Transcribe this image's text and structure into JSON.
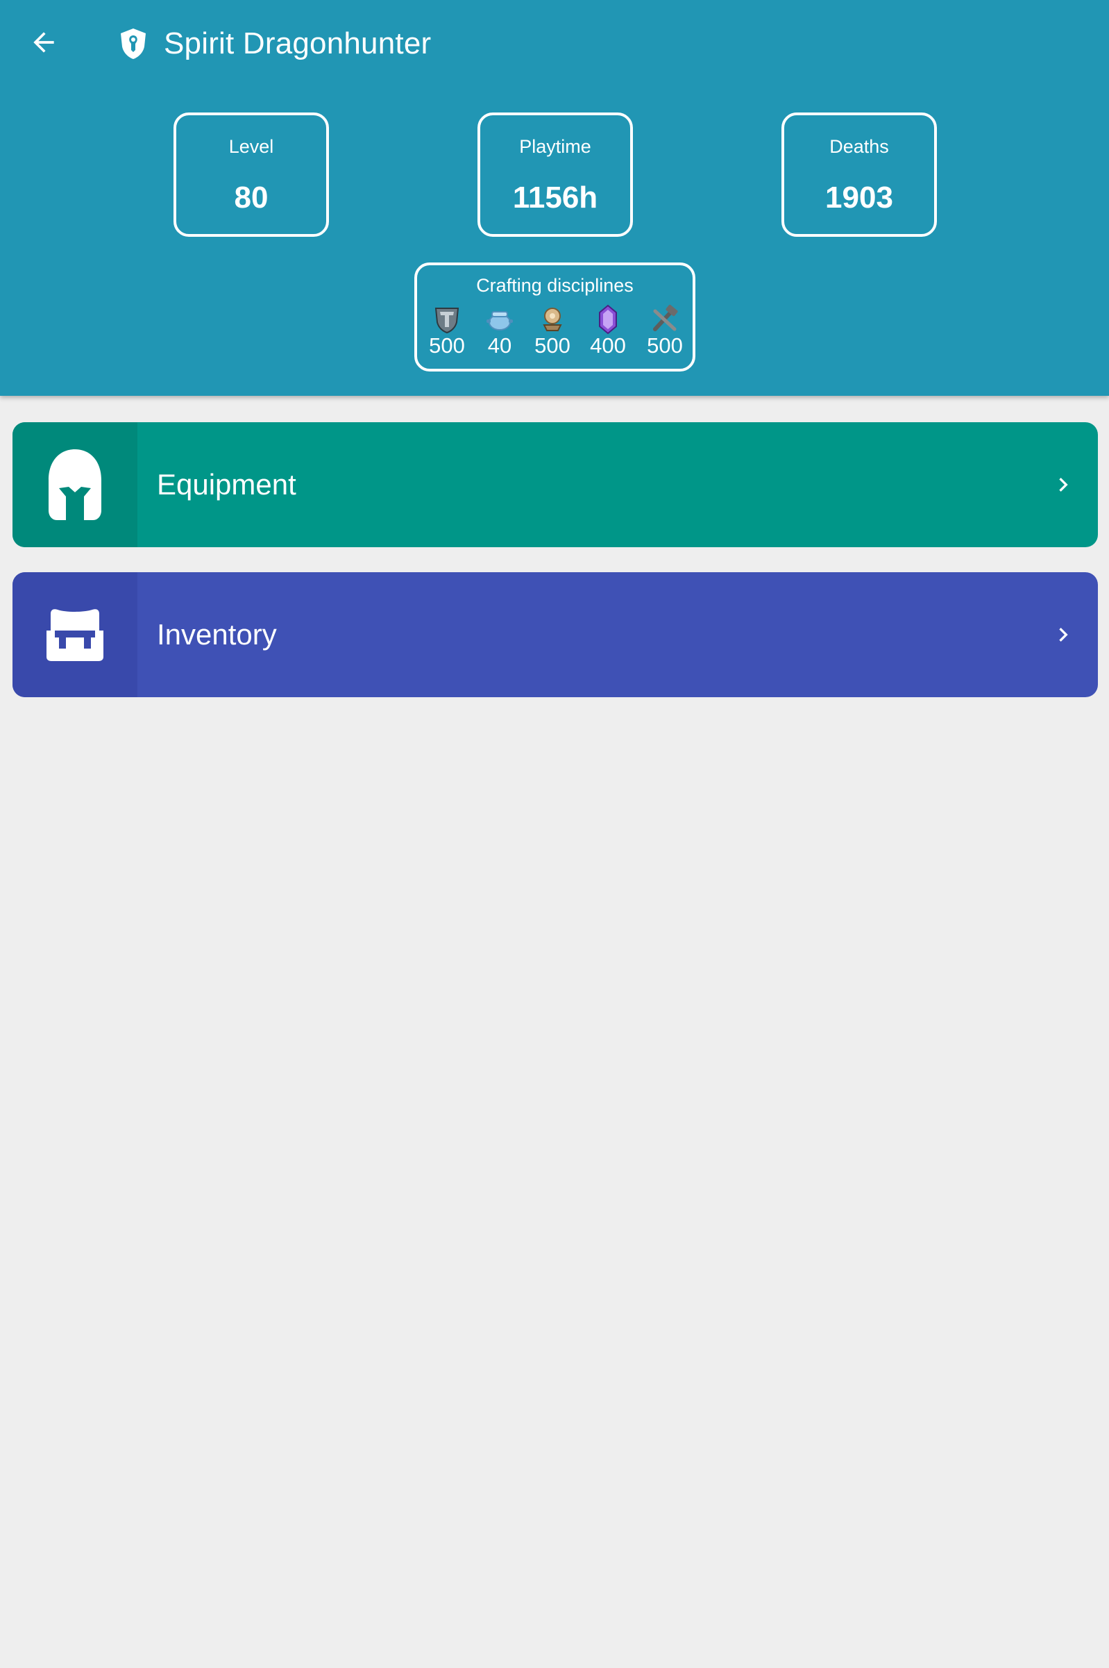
{
  "header": {
    "title": "Spirit Dragonhunter",
    "back_icon": "arrow-back-icon",
    "class_icon": "dragonhunter-icon",
    "background": "#2196b4"
  },
  "stats": {
    "level": {
      "label": "Level",
      "value": "80"
    },
    "playtime": {
      "label": "Playtime",
      "value": "1156h"
    },
    "deaths": {
      "label": "Deaths",
      "value": "1903"
    }
  },
  "crafting": {
    "label": "Crafting disciplines",
    "disciplines": [
      {
        "icon": "armorsmith-icon",
        "value": "500"
      },
      {
        "icon": "chef-icon",
        "value": "40"
      },
      {
        "icon": "artificer-icon",
        "value": "500"
      },
      {
        "icon": "jeweler-icon",
        "value": "400"
      },
      {
        "icon": "weaponsmith-icon",
        "value": "500"
      }
    ]
  },
  "menu": {
    "equipment": {
      "label": "Equipment",
      "icon": "helmet-icon",
      "color": "#009688"
    },
    "inventory": {
      "label": "Inventory",
      "icon": "bag-icon",
      "color": "#3f51b5"
    }
  }
}
